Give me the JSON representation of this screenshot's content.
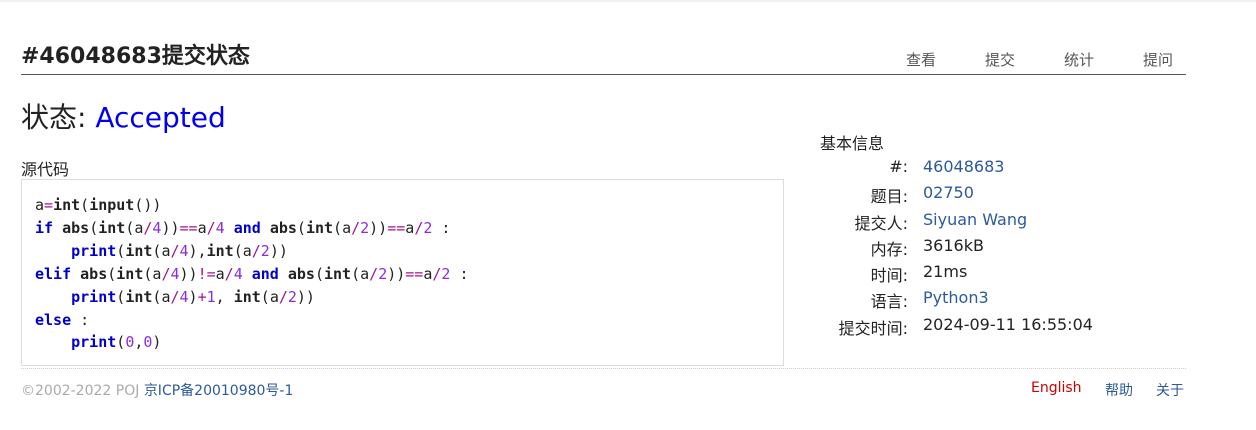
{
  "page": {
    "title": "#46048683提交状态"
  },
  "nav": {
    "items": [
      "查看",
      "提交",
      "统计",
      "提问"
    ]
  },
  "status": {
    "label": "状态:",
    "value": "Accepted"
  },
  "source": {
    "label": "源代码",
    "lines": [
      "a=int(input())",
      "if abs(int(a/4))==a/4 and abs(int(a/2))==a/2 :",
      "    print(int(a/4),int(a/2))",
      "elif abs(int(a/4))!=a/4 and abs(int(a/2))==a/2 :",
      "    print(int(a/4)+1, int(a/2))",
      "else :",
      "    print(0,0)"
    ]
  },
  "info": {
    "title": "基本信息",
    "rows": [
      {
        "key": "#:",
        "value": "46048683",
        "link": true
      },
      {
        "key": "题目:",
        "value": "02750",
        "link": true
      },
      {
        "key": "提交人:",
        "value": "Siyuan Wang",
        "link": true
      },
      {
        "key": "内存:",
        "value": "3616kB",
        "link": false
      },
      {
        "key": "时间:",
        "value": "21ms",
        "link": false
      },
      {
        "key": "语言:",
        "value": "Python3",
        "link": true
      },
      {
        "key": "提交时间:",
        "value": "2024-09-11 16:55:04",
        "link": false
      }
    ]
  },
  "footer": {
    "copyright": "©2002-2022 POJ",
    "icp": "京ICP备20010980号-1",
    "links": [
      "English",
      "帮助",
      "关于"
    ]
  },
  "colors": {
    "accepted": "#0000ee",
    "link": "#2c5a9a",
    "keyword": "#0000cc",
    "english": "#cc0000"
  }
}
